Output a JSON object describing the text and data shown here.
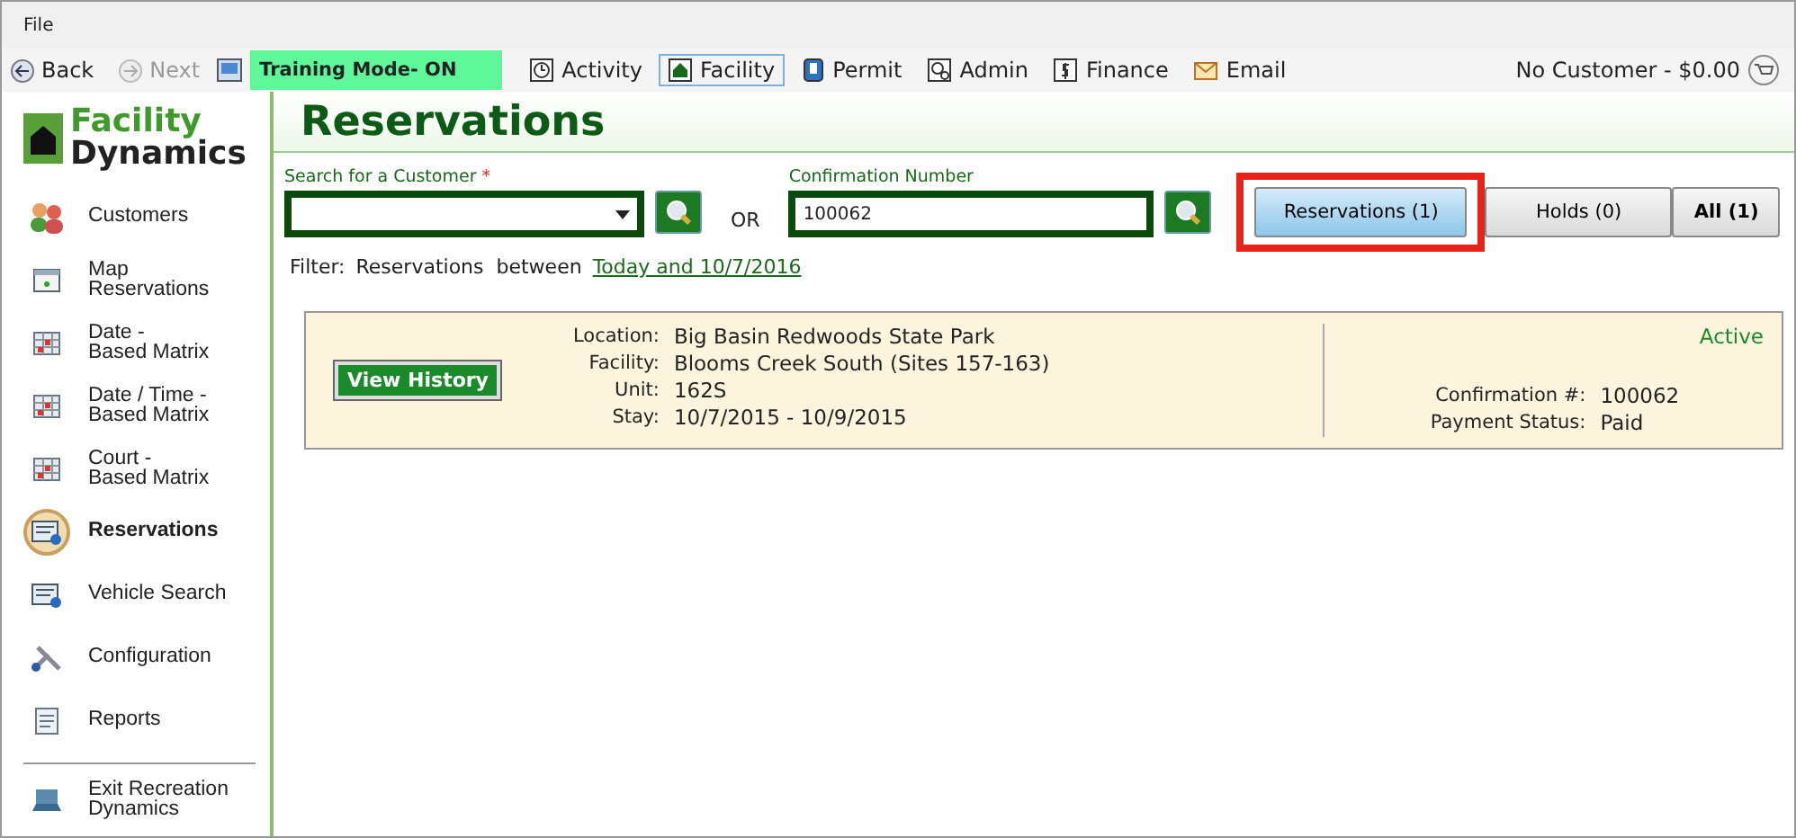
{
  "menu_bar": {
    "items": [
      "File"
    ]
  },
  "toolbar": {
    "back": "Back",
    "next": "Next",
    "training_mode": "Training Mode- ON",
    "modules": [
      {
        "label": "Activity",
        "kind": "clock",
        "selected": false
      },
      {
        "label": "Facility",
        "kind": "house",
        "selected": true
      },
      {
        "label": "Permit",
        "kind": "permit",
        "selected": false
      },
      {
        "label": "Admin",
        "kind": "admin",
        "selected": false
      },
      {
        "label": "Finance",
        "kind": "dollar",
        "selected": false
      },
      {
        "label": "Email",
        "kind": "mail",
        "selected": false
      }
    ],
    "customer_status": "No Customer - $0.00"
  },
  "sidebar": {
    "logo": [
      "Facility",
      "Dynamics"
    ],
    "items": [
      {
        "label": "Customers",
        "kind": "people",
        "selected": false
      },
      {
        "label": "Map\nReservations",
        "kind": "map",
        "selected": false
      },
      {
        "label": "Date -\nBased Matrix",
        "kind": "matrix",
        "selected": false
      },
      {
        "label": "Date / Time -\nBased Matrix",
        "kind": "matrix",
        "selected": false
      },
      {
        "label": "Court -\nBased Matrix",
        "kind": "matrix",
        "selected": false
      },
      {
        "label": "Reservations",
        "kind": "reservation",
        "selected": true
      },
      {
        "label": "Vehicle Search",
        "kind": "reservation",
        "selected": false
      },
      {
        "label": "Configuration",
        "kind": "tools",
        "selected": false
      },
      {
        "label": "Reports",
        "kind": "report",
        "selected": false
      }
    ],
    "exit": "Exit Recreation\nDynamics"
  },
  "page": {
    "title": "Reservations",
    "customer_search": {
      "label": "Search for a Customer",
      "required_mark": "*"
    },
    "or": "OR",
    "confirmation": {
      "label": "Confirmation Number",
      "value": "100062"
    },
    "result_tabs": [
      {
        "label": "Reservations (1)",
        "selected": true,
        "highlighted": true
      },
      {
        "label": "Holds (0)",
        "selected": false,
        "highlighted": false
      },
      {
        "label": "All (1)",
        "selected": false,
        "highlighted": false
      }
    ],
    "filter": {
      "label": "Filter:",
      "text": "Reservations  between",
      "link": "Today and 10/7/2016"
    },
    "reservations": [
      {
        "button": "View History",
        "details": [
          [
            "Location:",
            "Big Basin Redwoods State Park"
          ],
          [
            "Facility:",
            "Blooms Creek South (Sites 157-163)"
          ],
          [
            "Unit:",
            "162S"
          ],
          [
            "Stay:",
            "10/7/2015 - 10/9/2015"
          ]
        ],
        "status": "Active",
        "summary": [
          [
            "Confirmation #:",
            "100062"
          ],
          [
            "Payment Status:",
            "Paid"
          ]
        ]
      }
    ]
  }
}
